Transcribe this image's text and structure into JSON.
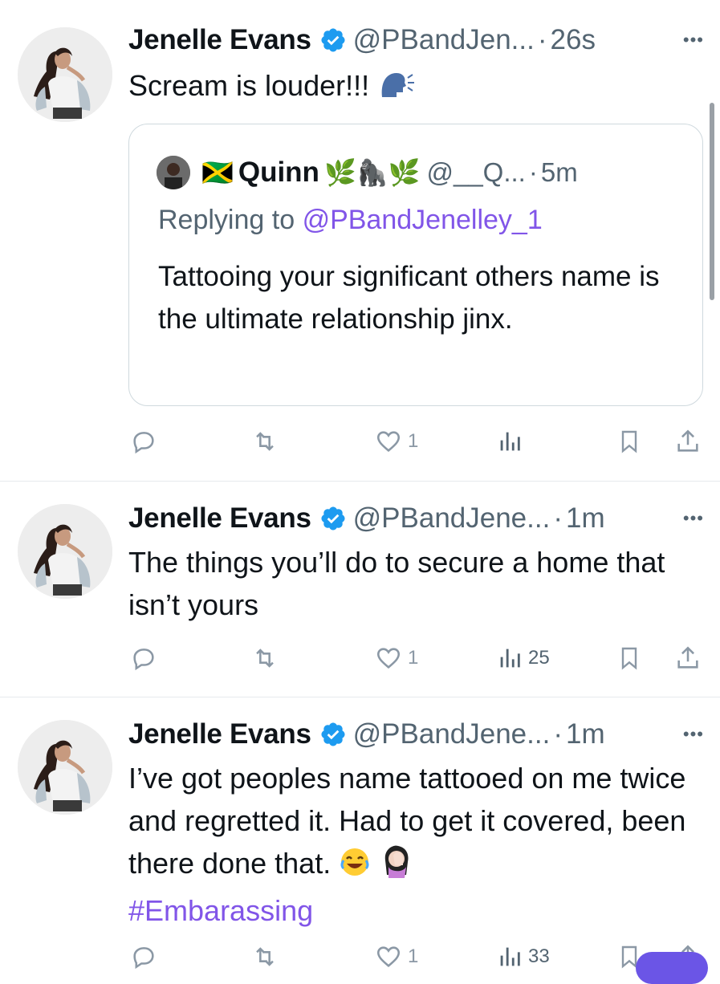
{
  "tweets": [
    {
      "name": "Jenelle Evans",
      "handle": "@PBandJen...",
      "time": "26s",
      "text": "Scream is louder!!!",
      "quote": {
        "flag": "🇯🇲",
        "name": "Quinn",
        "name_emojis": "🌿🦍🌿",
        "handle": "@__Q...",
        "time": "5m",
        "replying_prefix": "Replying to",
        "replying_to": "@PBandJenelley_1",
        "text": "Tattooing your significant others name is the ultimate relationship jinx."
      },
      "likes": "1",
      "views": ""
    },
    {
      "name": "Jenelle Evans",
      "handle": "@PBandJene...",
      "time": "1m",
      "text": "The things you’ll do to secure a home that isn’t yours",
      "likes": "1",
      "views": "25"
    },
    {
      "name": "Jenelle Evans",
      "handle": "@PBandJene...",
      "time": "1m",
      "text": "I’ve got peoples name tattooed on me twice and regretted it. Had to get it covered, been there done that.",
      "hashtag": "#Embarassing",
      "likes": "1",
      "views": "33"
    }
  ],
  "ui": {
    "separator": "·",
    "more": "•••"
  },
  "colors": {
    "accent": "#8155e8",
    "verified": "#1d9bf0",
    "muted": "#536471",
    "icon": "#8b98a5"
  },
  "icons": [
    "verified-badge-icon",
    "reply-icon",
    "retweet-icon",
    "like-icon",
    "views-icon",
    "bookmark-icon",
    "share-icon",
    "more-icon"
  ]
}
